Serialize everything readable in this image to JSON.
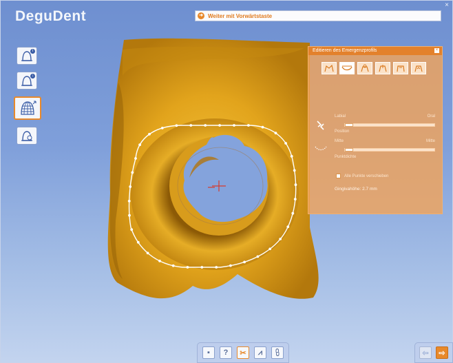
{
  "app": {
    "brand": "DeguDent",
    "close_glyph": "×"
  },
  "hint": {
    "text": "Weiter mit Vorwärtstaste",
    "icon": "arrow-right-circle-icon"
  },
  "sidebar": {
    "tools": [
      {
        "id": "info",
        "icon": "tooth-info-icon"
      },
      {
        "id": "edit",
        "icon": "tooth-edit-icon"
      },
      {
        "id": "mesh",
        "icon": "mesh-grid-icon",
        "active": true
      },
      {
        "id": "settings",
        "icon": "tooth-settings-icon"
      }
    ]
  },
  "panel": {
    "title": "Editieren des Emergenzprofils",
    "close_glyph": "×",
    "profile_buttons": [
      "profile-1-icon",
      "profile-2-icon",
      "profile-3-icon",
      "profile-4-icon",
      "profile-5-icon",
      "profile-6-icon"
    ],
    "position": {
      "left_label": "Labial",
      "right_label": "Oral",
      "label": "Position",
      "value": 0
    },
    "point_size": {
      "left_label": "Mitte",
      "right_label": "Mitte",
      "label": "Punktdichte",
      "value": 0
    },
    "checkbox_label": "Alle Punkte verschieben",
    "gingiva": "Gingivahöhe: 2.7 mm"
  },
  "toolbar": {
    "buttons": [
      {
        "id": "save",
        "glyph": "▪"
      },
      {
        "id": "help",
        "glyph": "?"
      },
      {
        "id": "cut",
        "glyph": "✂"
      },
      {
        "id": "crown",
        "glyph": "⩘"
      },
      {
        "id": "bridge",
        "glyph": "⩉"
      }
    ]
  },
  "nav": {
    "back_glyph": "⇦",
    "next_glyph": "⇨"
  },
  "colors": {
    "accent": "#e8892b",
    "model": "#e0a520",
    "background": "#7f9fda"
  }
}
